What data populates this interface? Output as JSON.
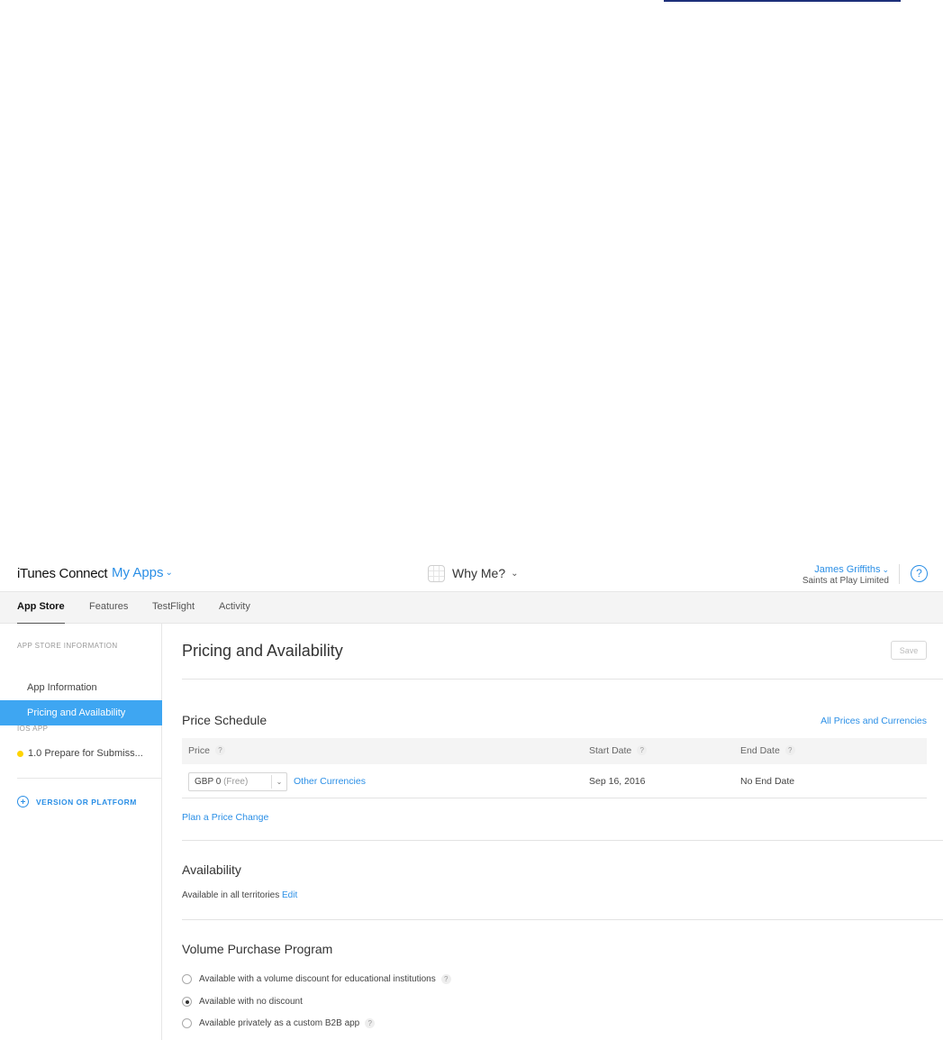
{
  "header": {
    "brand": "iTunes Connect",
    "my_apps": "My Apps",
    "app_name": "Why Me?",
    "user_name": "James Griffiths",
    "user_org": "Saints at Play Limited",
    "help_icon": "?",
    "chevron": "⌄"
  },
  "tabs": [
    {
      "label": "App Store",
      "active": true
    },
    {
      "label": "Features"
    },
    {
      "label": "TestFlight"
    },
    {
      "label": "Activity"
    }
  ],
  "sidebar": {
    "section1": "APP STORE INFORMATION",
    "items": [
      {
        "label": "App Information"
      },
      {
        "label": "Pricing and Availability",
        "active": true
      }
    ],
    "section2": "IOS APP",
    "version": "1.0 Prepare for Submiss...",
    "add_version": "VERSION OR PLATFORM"
  },
  "main": {
    "title": "Pricing and Availability",
    "save": "Save",
    "price_schedule": {
      "title": "Price Schedule",
      "all_prices_link": "All Prices and Currencies",
      "headers": {
        "price": "Price",
        "start": "Start Date",
        "end": "End Date",
        "help": "?"
      },
      "row": {
        "price_value": "GBP 0",
        "price_note": "(Free)",
        "other_currencies": "Other Currencies",
        "start": "Sep 16, 2016",
        "end": "No End Date"
      },
      "plan_link": "Plan a Price Change"
    },
    "availability": {
      "title": "Availability",
      "text": "Available in all territories",
      "edit": "Edit"
    },
    "vpp": {
      "title": "Volume Purchase Program",
      "options": [
        {
          "label": "Available with a volume discount for educational institutions",
          "help": "?",
          "checked": false
        },
        {
          "label": "Available with no discount",
          "checked": true
        },
        {
          "label": "Available privately as a custom B2B app",
          "help": "?",
          "checked": false
        }
      ]
    }
  },
  "colors": {
    "accent": "#2b8fe6",
    "active_sidebar": "#3ea6f2",
    "status_dot": "#ffd400"
  }
}
